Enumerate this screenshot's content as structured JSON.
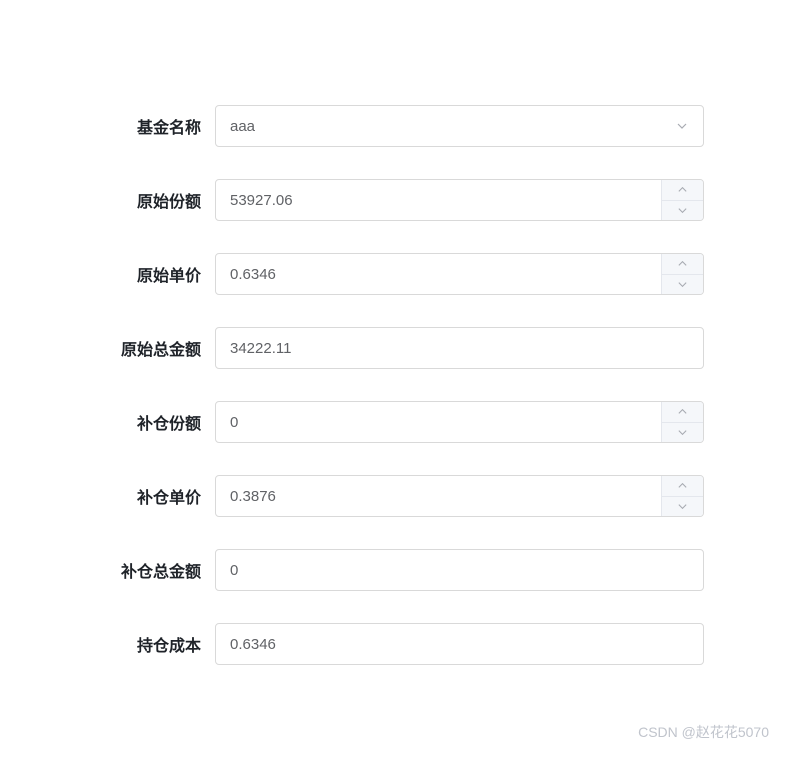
{
  "form": {
    "fund_name": {
      "label": "基金名称",
      "value": "aaa"
    },
    "original_share": {
      "label": "原始份额",
      "value": "53927.06"
    },
    "original_price": {
      "label": "原始单价",
      "value": "0.6346"
    },
    "original_total": {
      "label": "原始总金额",
      "value": "34222.11"
    },
    "add_share": {
      "label": "补仓份额",
      "value": "0"
    },
    "add_price": {
      "label": "补仓单价",
      "value": "0.3876"
    },
    "add_total": {
      "label": "补仓总金额",
      "value": "0"
    },
    "position_cost": {
      "label": "持仓成本",
      "value": "0.6346"
    }
  },
  "watermark": "CSDN @赵花花5070"
}
